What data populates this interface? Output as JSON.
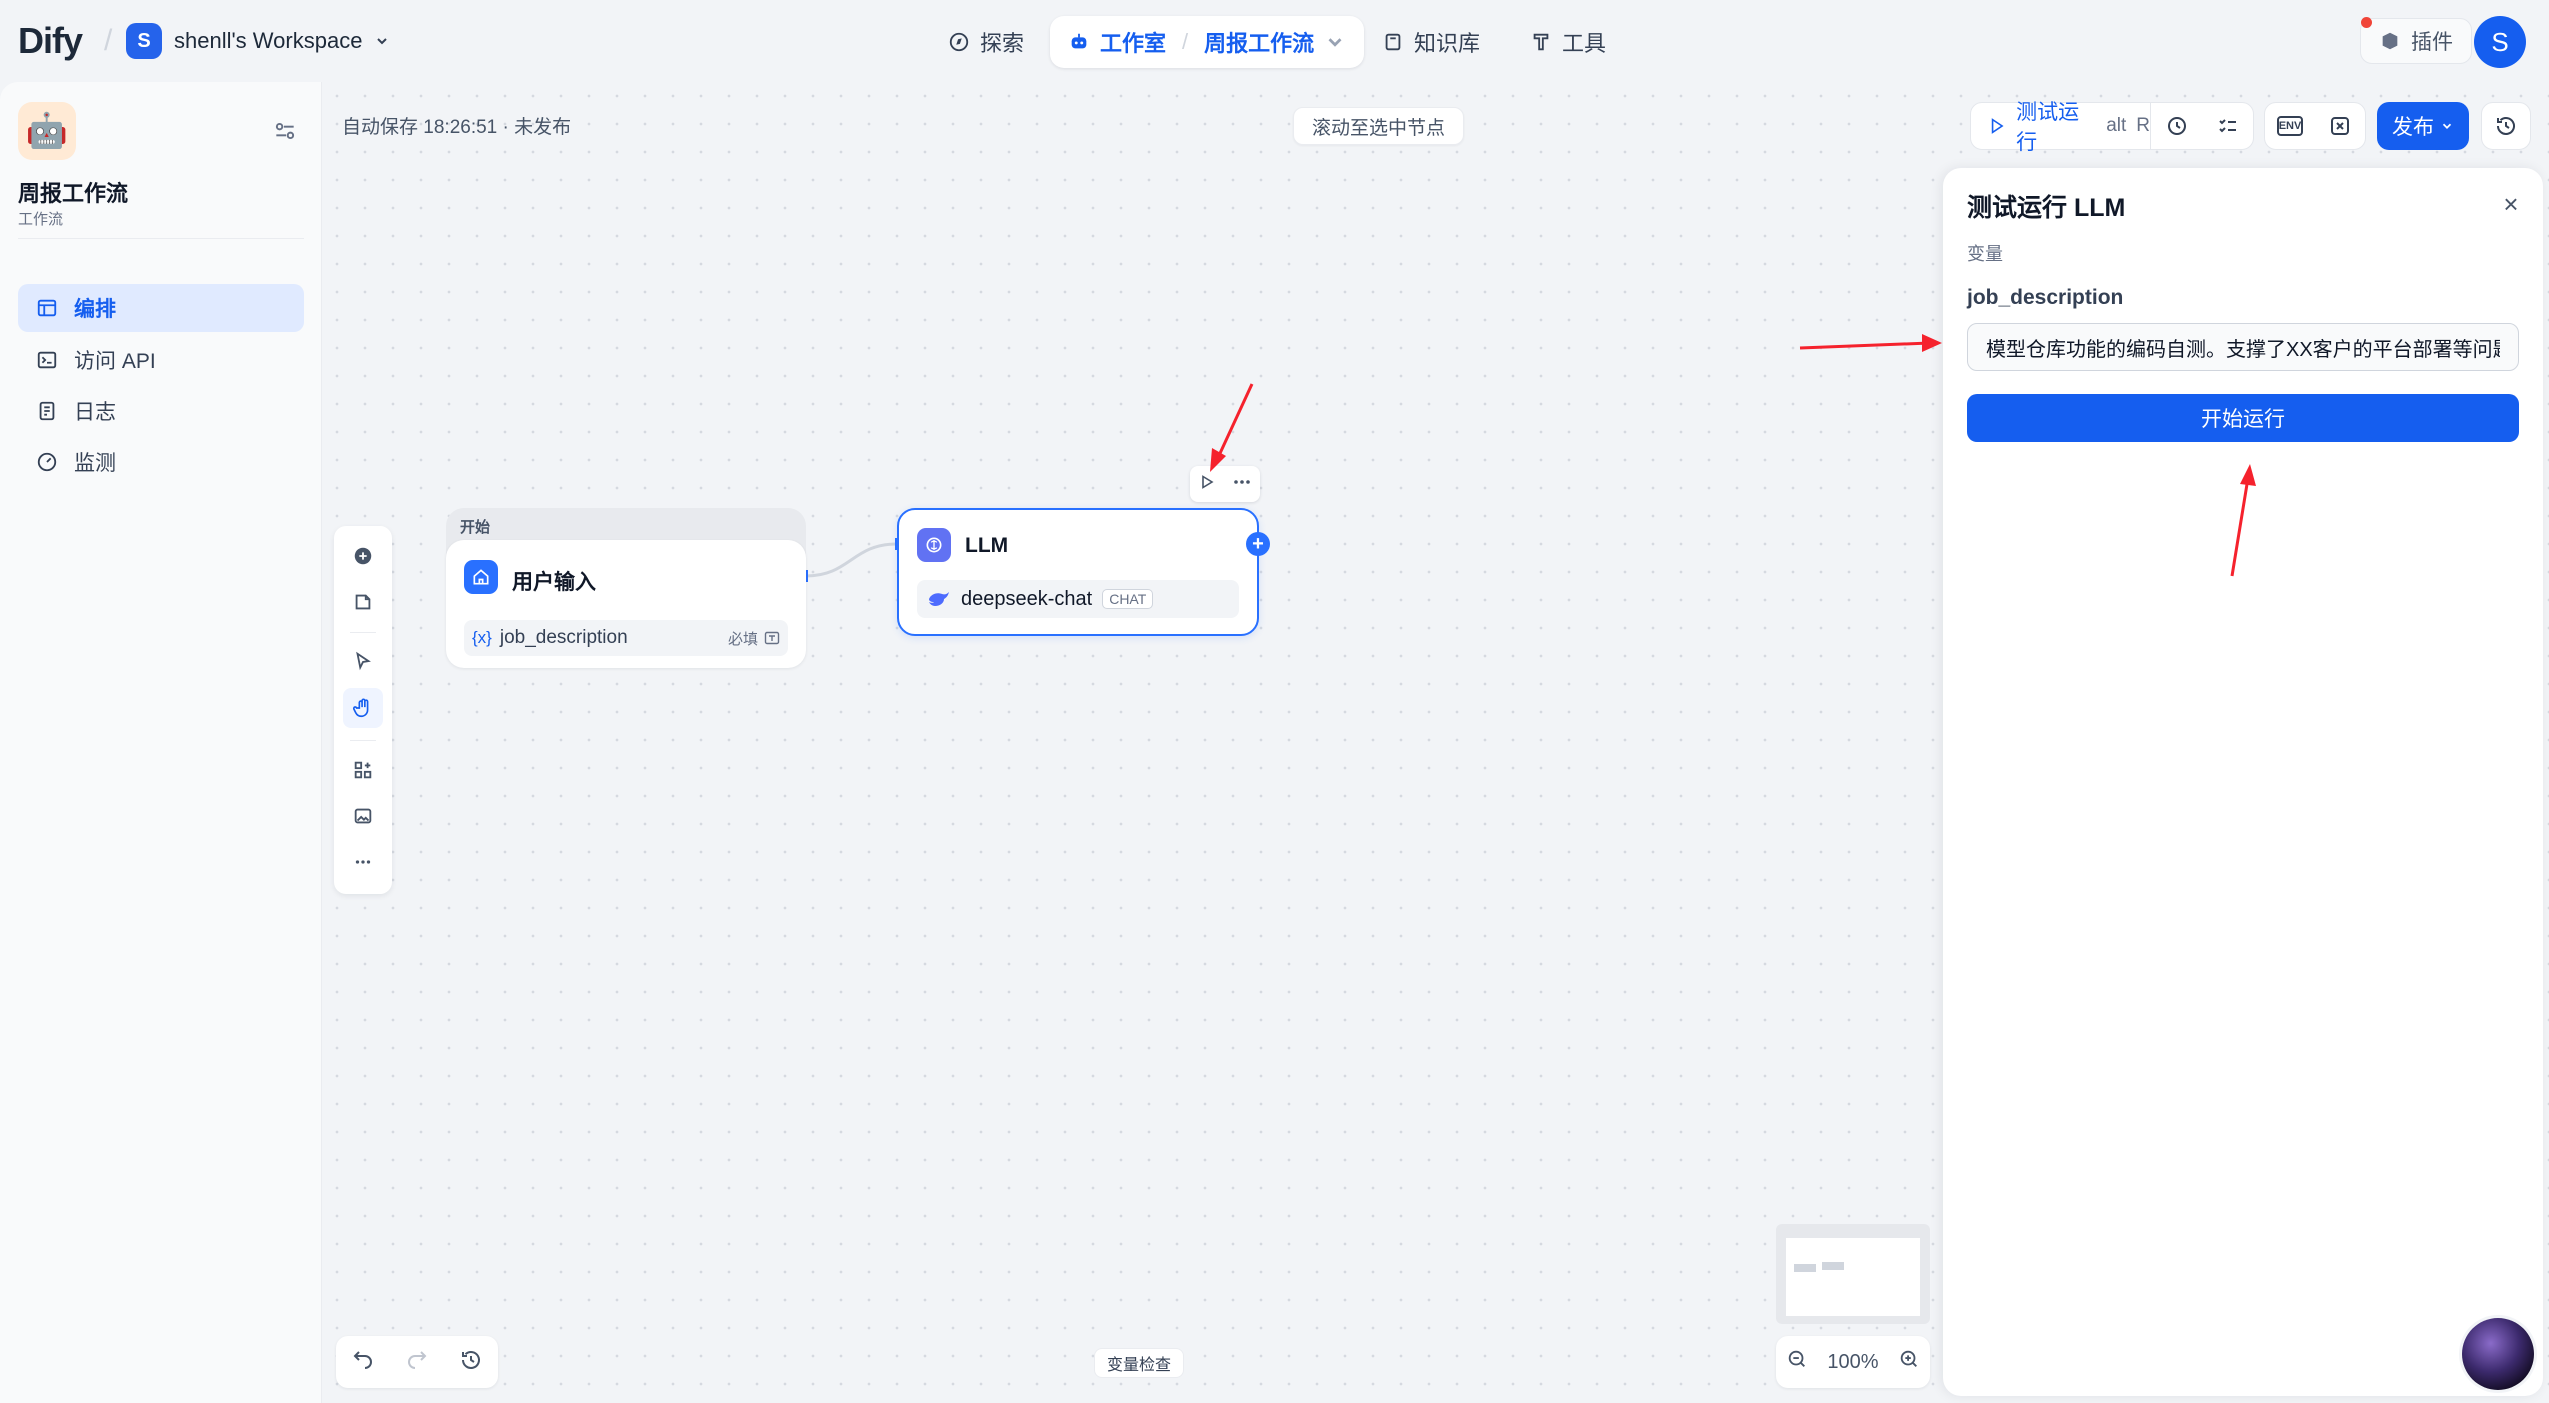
{
  "brand": {
    "logo": "Dify"
  },
  "workspace": {
    "badge": "S",
    "name": "shenll's Workspace"
  },
  "nav": {
    "explore": "探索",
    "studio": "工作室",
    "app_crumb": "周报工作流",
    "knowledge": "知识库",
    "tools": "工具",
    "plugins": "插件"
  },
  "user": {
    "avatar": "S"
  },
  "sidebar": {
    "app_name": "周报工作流",
    "app_type": "工作流",
    "items": [
      {
        "label": "编排",
        "icon": "layout-icon"
      },
      {
        "label": "访问 API",
        "icon": "terminal-icon"
      },
      {
        "label": "日志",
        "icon": "file-list-icon"
      },
      {
        "label": "监测",
        "icon": "dashboard-icon"
      }
    ]
  },
  "canvas": {
    "autosave": "自动保存 18:26:51 · 未发布",
    "scroll_to_node": "滚动至选中节点",
    "variable_inspect": "变量检查",
    "zoom": "100%"
  },
  "toolbar": {
    "test_run": "测试运行",
    "shortcut_alt": "alt",
    "shortcut_key": "R",
    "env": "ENV",
    "publish": "发布"
  },
  "nodes": {
    "start": {
      "header": "开始",
      "title": "用户输入",
      "var_prefix": "{x}",
      "var_name": "job_description",
      "required": "必填"
    },
    "llm": {
      "title": "LLM",
      "model": "deepseek-chat",
      "mode": "CHAT"
    }
  },
  "panel": {
    "title": "测试运行 LLM",
    "subtitle": "变量",
    "field_label": "job_description",
    "field_value": "模型仓库功能的编码自测。支撑了XX客户的平台部署等问题",
    "start_button": "开始运行",
    "close": "×"
  },
  "colors": {
    "primary": "#155eef",
    "annotation": "#f5222d"
  }
}
